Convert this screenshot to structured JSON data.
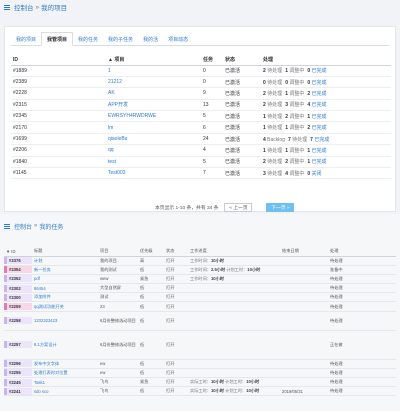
{
  "top": {
    "breadcrumb": {
      "root": "控制台",
      "sep": "»",
      "page": "我的项目"
    },
    "tabs": [
      {
        "label": "我的项目",
        "active": false
      },
      {
        "label": "我管项目",
        "active": true
      },
      {
        "label": "我的任务",
        "active": false
      },
      {
        "label": "我的子任务",
        "active": false
      },
      {
        "label": "我的活",
        "active": false
      },
      {
        "label": "项目动态",
        "active": false
      }
    ],
    "table": {
      "headers": [
        "ID",
        "▲ 项目",
        "任务",
        "状态",
        "处理"
      ],
      "rows": [
        {
          "id": "#1889",
          "name": "1",
          "tasks": "0",
          "status": "已激活",
          "p": [
            [
              "2",
              "待处理"
            ],
            [
              "1",
              "调整中"
            ],
            [
              "0",
              "已完成"
            ]
          ]
        },
        {
          "id": "#2389",
          "name": "21212",
          "tasks": "0",
          "status": "已激活",
          "p": [
            [
              "0",
              "待处理"
            ],
            [
              "0",
              "调整中"
            ],
            [
              "0",
              "已完成"
            ]
          ]
        },
        {
          "id": "#2228",
          "name": "AK",
          "tasks": "9",
          "status": "已激活",
          "p": [
            [
              "2",
              "待处理"
            ],
            [
              "1",
              "调整中"
            ],
            [
              "2",
              "已完成"
            ]
          ]
        },
        {
          "id": "#2315",
          "name": "APP开发",
          "tasks": "13",
          "status": "已激活",
          "p": [
            [
              "2",
              "待处理"
            ],
            [
              "3",
              "调整中"
            ],
            [
              "4",
              "已完成"
            ]
          ]
        },
        {
          "id": "#2345",
          "name": "EWRSYH4RWDRWE",
          "tasks": "5",
          "status": "已激活",
          "p": [
            [
              "1",
              "待处理"
            ],
            [
              "2",
              "调整中"
            ],
            [
              "1",
              "已完成"
            ]
          ]
        },
        {
          "id": "#2170",
          "name": "lm",
          "tasks": "6",
          "status": "已激活",
          "p": [
            [
              "1",
              "待处理"
            ],
            [
              "1",
              "调整中"
            ],
            [
              "2",
              "已完成"
            ]
          ]
        },
        {
          "id": "#1699",
          "name": "qiaoleBu",
          "tasks": "24",
          "status": "已激活",
          "p": [
            [
              "4",
              "Backlog"
            ],
            [
              "7",
              "待处理"
            ],
            [
              "7",
              "已完成"
            ]
          ]
        },
        {
          "id": "#2206",
          "name": "qq",
          "tasks": "4",
          "status": "已激活",
          "p": [
            [
              "1",
              "待处理"
            ],
            [
              "1",
              "调整中"
            ],
            [
              "1",
              "已完成"
            ]
          ]
        },
        {
          "id": "#1840",
          "name": "test",
          "tasks": "5",
          "status": "已激活",
          "p": [
            [
              "2",
              "待处理"
            ],
            [
              "2",
              "调整中"
            ],
            [
              "1",
              "已完成"
            ]
          ]
        },
        {
          "id": "#1145",
          "name": "Test003",
          "tasks": "7",
          "status": "已激活",
          "p": [
            [
              "3",
              "待处理"
            ],
            [
              "4",
              "调整中"
            ],
            [
              "0",
              "关闭"
            ]
          ]
        }
      ]
    },
    "pager": {
      "text": "本页显示 1-10 条，共有 34 条",
      "prev": "« 上一页",
      "next": "下一页 »"
    }
  },
  "bottom": {
    "breadcrumb": {
      "root": "控制台",
      "sep": "»",
      "page": "我的任务"
    },
    "table": {
      "headers": [
        "▼ ID",
        "标题",
        "项目",
        "优先级",
        "状态",
        "工作进度",
        "结束日期",
        "处理"
      ],
      "rows": [
        {
          "id": "#2376",
          "title": "计划",
          "project": "我的项目",
          "prio": "高",
          "status": "打开",
          "work": "",
          "end": "",
          "action": "待处理",
          "h": "",
          "pink": false
        },
        {
          "id": "#2354",
          "title": "新一任务",
          "project": "我的测试",
          "prio": "低",
          "status": "打开",
          "work": "",
          "end": "",
          "action": "准备中",
          "h": "",
          "pink": true
        },
        {
          "id": "#2352",
          "title": "pdf",
          "project": "wew",
          "prio": "紧急",
          "status": "打开",
          "work": "",
          "end": "",
          "action": "待处理",
          "h": "",
          "pink": false
        },
        {
          "id": "#2302",
          "title": "86454",
          "project": "大型自然屏",
          "prio": "低",
          "status": "打开",
          "work": "",
          "end": "",
          "action": "待处理",
          "h": "",
          "pink": false
        },
        {
          "id": "#2300",
          "title": "添加附件",
          "project": "测试",
          "prio": "低",
          "status": "打开",
          "work": "",
          "end": "",
          "action": "待处理",
          "h": "",
          "pink": false
        },
        {
          "id": "#2259",
          "title": "qq测试功能开关",
          "project": "23",
          "prio": "低",
          "status": "打开",
          "work": "",
          "end": "",
          "action": "待处理",
          "h": "",
          "pink": true
        },
        {
          "id": "#2258",
          "title": "1232323423",
          "project": "6月份整修选动项目",
          "prio": "低",
          "status": "打开",
          "work": "",
          "end": "",
          "action": "待处理",
          "h": "mid",
          "pink": false
        },
        {
          "id": "#2257",
          "title": "6.1方案设计",
          "project": "6月份整修选动项目",
          "prio": "低",
          "status": "打开",
          "work": "",
          "end": "",
          "action": "正在做",
          "h": "tall",
          "pink": false
        },
        {
          "id": "#2256",
          "title": "发布中文字体",
          "project": "ew",
          "prio": "低",
          "status": "打开",
          "work": "",
          "end": "",
          "action": "待处理",
          "h": "",
          "pink": false
        },
        {
          "id": "#2255",
          "title": "处理打表时对位置",
          "project": "ew",
          "prio": "低",
          "status": "打开",
          "work": "",
          "end": "",
          "action": "待处理",
          "h": "",
          "pink": false
        },
        {
          "id": "#2245",
          "title": "Task1",
          "project": "飞鸟",
          "prio": "紧急",
          "status": "打开",
          "work": "",
          "end": "",
          "action": "待处理",
          "h": "",
          "pink": false
        },
        {
          "id": "#2241",
          "title": "sdo sco",
          "project": "飞鸟",
          "prio": "低",
          "status": "打开",
          "work": "",
          "end": "2019/05/31",
          "action": "待处理",
          "h": "",
          "pink": false
        }
      ],
      "work": {
        "r0": {
          "label": "工作时间：",
          "val": "10小时"
        },
        "r1": {
          "a_label": "工作时间：",
          "a_val": "2.5小时",
          "b_label": "计划工时：",
          "b_val": "10小时"
        },
        "r2": {
          "label": "工作时间：",
          "val": "10小时"
        },
        "r10": {
          "a_label": "实际工时：",
          "a_val": "10小时",
          "b_label": "计划工时：",
          "b_val": "10小时"
        },
        "r11": {
          "a_label": "实际工时：",
          "a_val": "10小时",
          "b_label": "计划工时：",
          "b_val": "10小时"
        }
      }
    }
  },
  "colors": {
    "accent": "#2d7bd2",
    "next_button": "#6ec0f0",
    "id_tag": "#ece4fb",
    "id_tag_pink": "#f7d7e8"
  }
}
